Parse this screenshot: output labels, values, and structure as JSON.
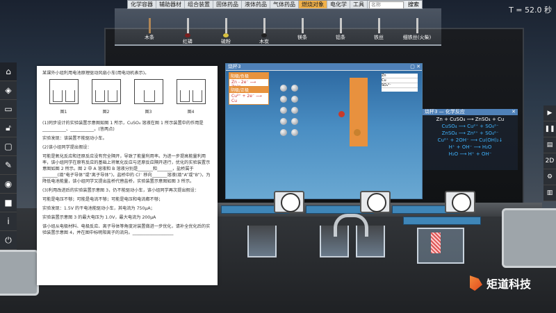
{
  "timer": "T = 52.0 秒",
  "menu": {
    "tabs": [
      "化学容器",
      "辅助器材",
      "组合装置",
      "固体药品",
      "液体药品",
      "气体药品",
      "燃烧对象",
      "电化学",
      "工具"
    ],
    "active_index": 6,
    "search_placeholder": "名称",
    "search_button": "搜索"
  },
  "shelf": {
    "items": [
      "木条",
      "红磷",
      "硫粉",
      "木炭",
      "镁条",
      "铝条",
      "铁丝",
      "细铁丝(火柴)"
    ]
  },
  "left_toolbar": [
    "home-icon",
    "layers-icon",
    "message-icon",
    "lock-icon",
    "monitor-icon",
    "brush-icon",
    "camera-icon",
    "video-icon",
    "info-icon",
    "power-icon"
  ],
  "right_toolbar": [
    "play-icon",
    "pause-icon",
    "toolbox-icon",
    "2D",
    "settings-icon",
    "trash-icon"
  ],
  "document": {
    "intro": "某课外小组利用电池原理驱动风扇小车(用电动机表示)。",
    "fig_labels": [
      "图1",
      "图2",
      "图3",
      "图4"
    ],
    "q1": "(1)同步设计的实验装置示意图如图 1 所示，CuSO₄ 溶液在图 1 所示装置中的作用是___________、___________。(答两点)",
    "q1_note": "实验发现：该装置不能驱动小车。",
    "q2_title": "(2)该小组同学提出假设：",
    "q2_body": "可能是氧化反应和还原反应没有完全隔开，导致了能量利用率。为进一步提高能量利用率，该小组同学在原有反应的基础上将氧化反应与还原反应隔开进行，优化的实验装置示意图如图 2 所示。图 2 中 A 溶液和 B 溶液分别是_______和_______，盐桥属于_______(填“电子导体”或“离子导体”)，盐桥中的 Cl⁻ 移向_______溶液(填“A”或“B”)，为降低电池能量，该小组同学又提出盐桥代替盐桥，实验装置示意图如图 3 所示。",
    "q3_title": "(3)利用改进后的实验装置示意图 3，仍不能驱动小车，该小组同学再次提出假设：",
    "q3_body": "可能是电压不够；可能是电流不够；可能是电压和电流都不够；",
    "q3_note1": "实验发现：1.5V 的干电池能驱动小车，其电流为 750μA；",
    "q3_note2": "实验装置示意图 3 的最大电压为 1.0V，最大电流为 200μA",
    "q3_note3": "该小组从电极材料、电极反应、离子导体等角度对装置做进一步优化，请补全优化后的实验装置示意图 4，并在图中标明阳离子的流向。___________________"
  },
  "beaker_panel": {
    "title": "烧杯3",
    "eq_top_label": "阳极/负极",
    "eq_top": "Zn - 2e⁻ ⟶ Zn²⁺",
    "eq_bottom_label": "阴极/正极",
    "eq_bottom": "Cu²⁺ + 2e⁻ ⟶ Cu",
    "legend": [
      "Zn",
      "Cu",
      "SO₄²⁻"
    ]
  },
  "reaction_panel": {
    "title": "烧杯3 — 化学反应",
    "main_eq": "Zn + CuSO₄ ⟶ ZnSO₄ + Cu",
    "ion_lines": [
      "CuSO₄ ⟶ Cu²⁺ + SO₄²⁻",
      "ZnSO₄ ⟶ Zn²⁺ + SO₄²⁻",
      "Cu²⁺ + 2OH⁻ ⟶ Cu(OH)₂↓",
      "H⁺ + OH⁻ ⟶ H₂O",
      "H₂O ⟶ H⁺ + OH⁻"
    ]
  },
  "brand": "矩道科技",
  "colors": {
    "active_tab": "#f1b14a",
    "accent": "#e8913e",
    "panel_title": "#4f81b8"
  }
}
